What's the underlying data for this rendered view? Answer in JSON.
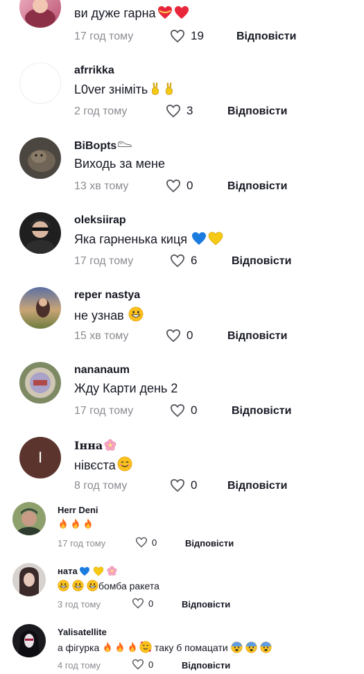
{
  "comments": [
    {
      "username": "",
      "text": "ви дуже гарна",
      "time": "17 год тому",
      "likes": "19",
      "reply": "Відповісти",
      "emoji": [
        "heart-ribbon-icon",
        "heart-red-icon"
      ]
    },
    {
      "username": "afrrikka",
      "text": "L0ver зніміть",
      "time": "2 год тому",
      "likes": "3",
      "reply": "Відповісти",
      "emoji": [
        "victory-hand-icon",
        "victory-hand-icon"
      ]
    },
    {
      "username": "BiBopts",
      "text": "Виходь за мене",
      "time": "13 хв тому",
      "likes": "0",
      "reply": "Відповісти",
      "emoji": [
        "shoe-icon"
      ]
    },
    {
      "username": "oleksiirap",
      "text": "Яка гарненька киця",
      "time": "17 год тому",
      "likes": "6",
      "reply": "Відповісти",
      "emoji": [
        "blue-heart-icon",
        "yellow-heart-icon"
      ]
    },
    {
      "username": "reper nastya",
      "text": "не узнав",
      "time": "15 хв тому",
      "likes": "0",
      "reply": "Відповісти",
      "emoji": [
        "grinning-face-icon"
      ]
    },
    {
      "username": "nananaum",
      "text": "Жду Карти день 2",
      "time": "17 год тому",
      "likes": "0",
      "reply": "Відповісти"
    },
    {
      "username": "Інна",
      "text": "нівєста",
      "time": "8 год тому",
      "likes": "0",
      "reply": "Відповісти",
      "emoji": [
        "cherry-blossom-icon",
        "smiling-face-icon"
      ]
    },
    {
      "username": "Herr Deni",
      "text": "",
      "time": "17 год тому",
      "likes": "0",
      "reply": "Відповісти",
      "emoji": [
        "fire-icon",
        "fire-icon",
        "fire-icon"
      ]
    },
    {
      "username": "ната",
      "text": "бомба ракета",
      "time": "3 год тому",
      "likes": "0",
      "reply": "Відповісти",
      "emoji": [
        "blue-heart-icon",
        "yellow-heart-icon",
        "cherry-blossom-icon",
        "grinning-face-icon"
      ]
    },
    {
      "username": "Yalisatellite",
      "text_before": "а фігурка",
      "text_after": "таку б помацати",
      "time": "4 год тому",
      "likes": "0",
      "reply": "Відповісти",
      "emoji": [
        "fire-icon",
        "smiling-hearts-face-icon",
        "anxious-face-icon"
      ]
    }
  ]
}
